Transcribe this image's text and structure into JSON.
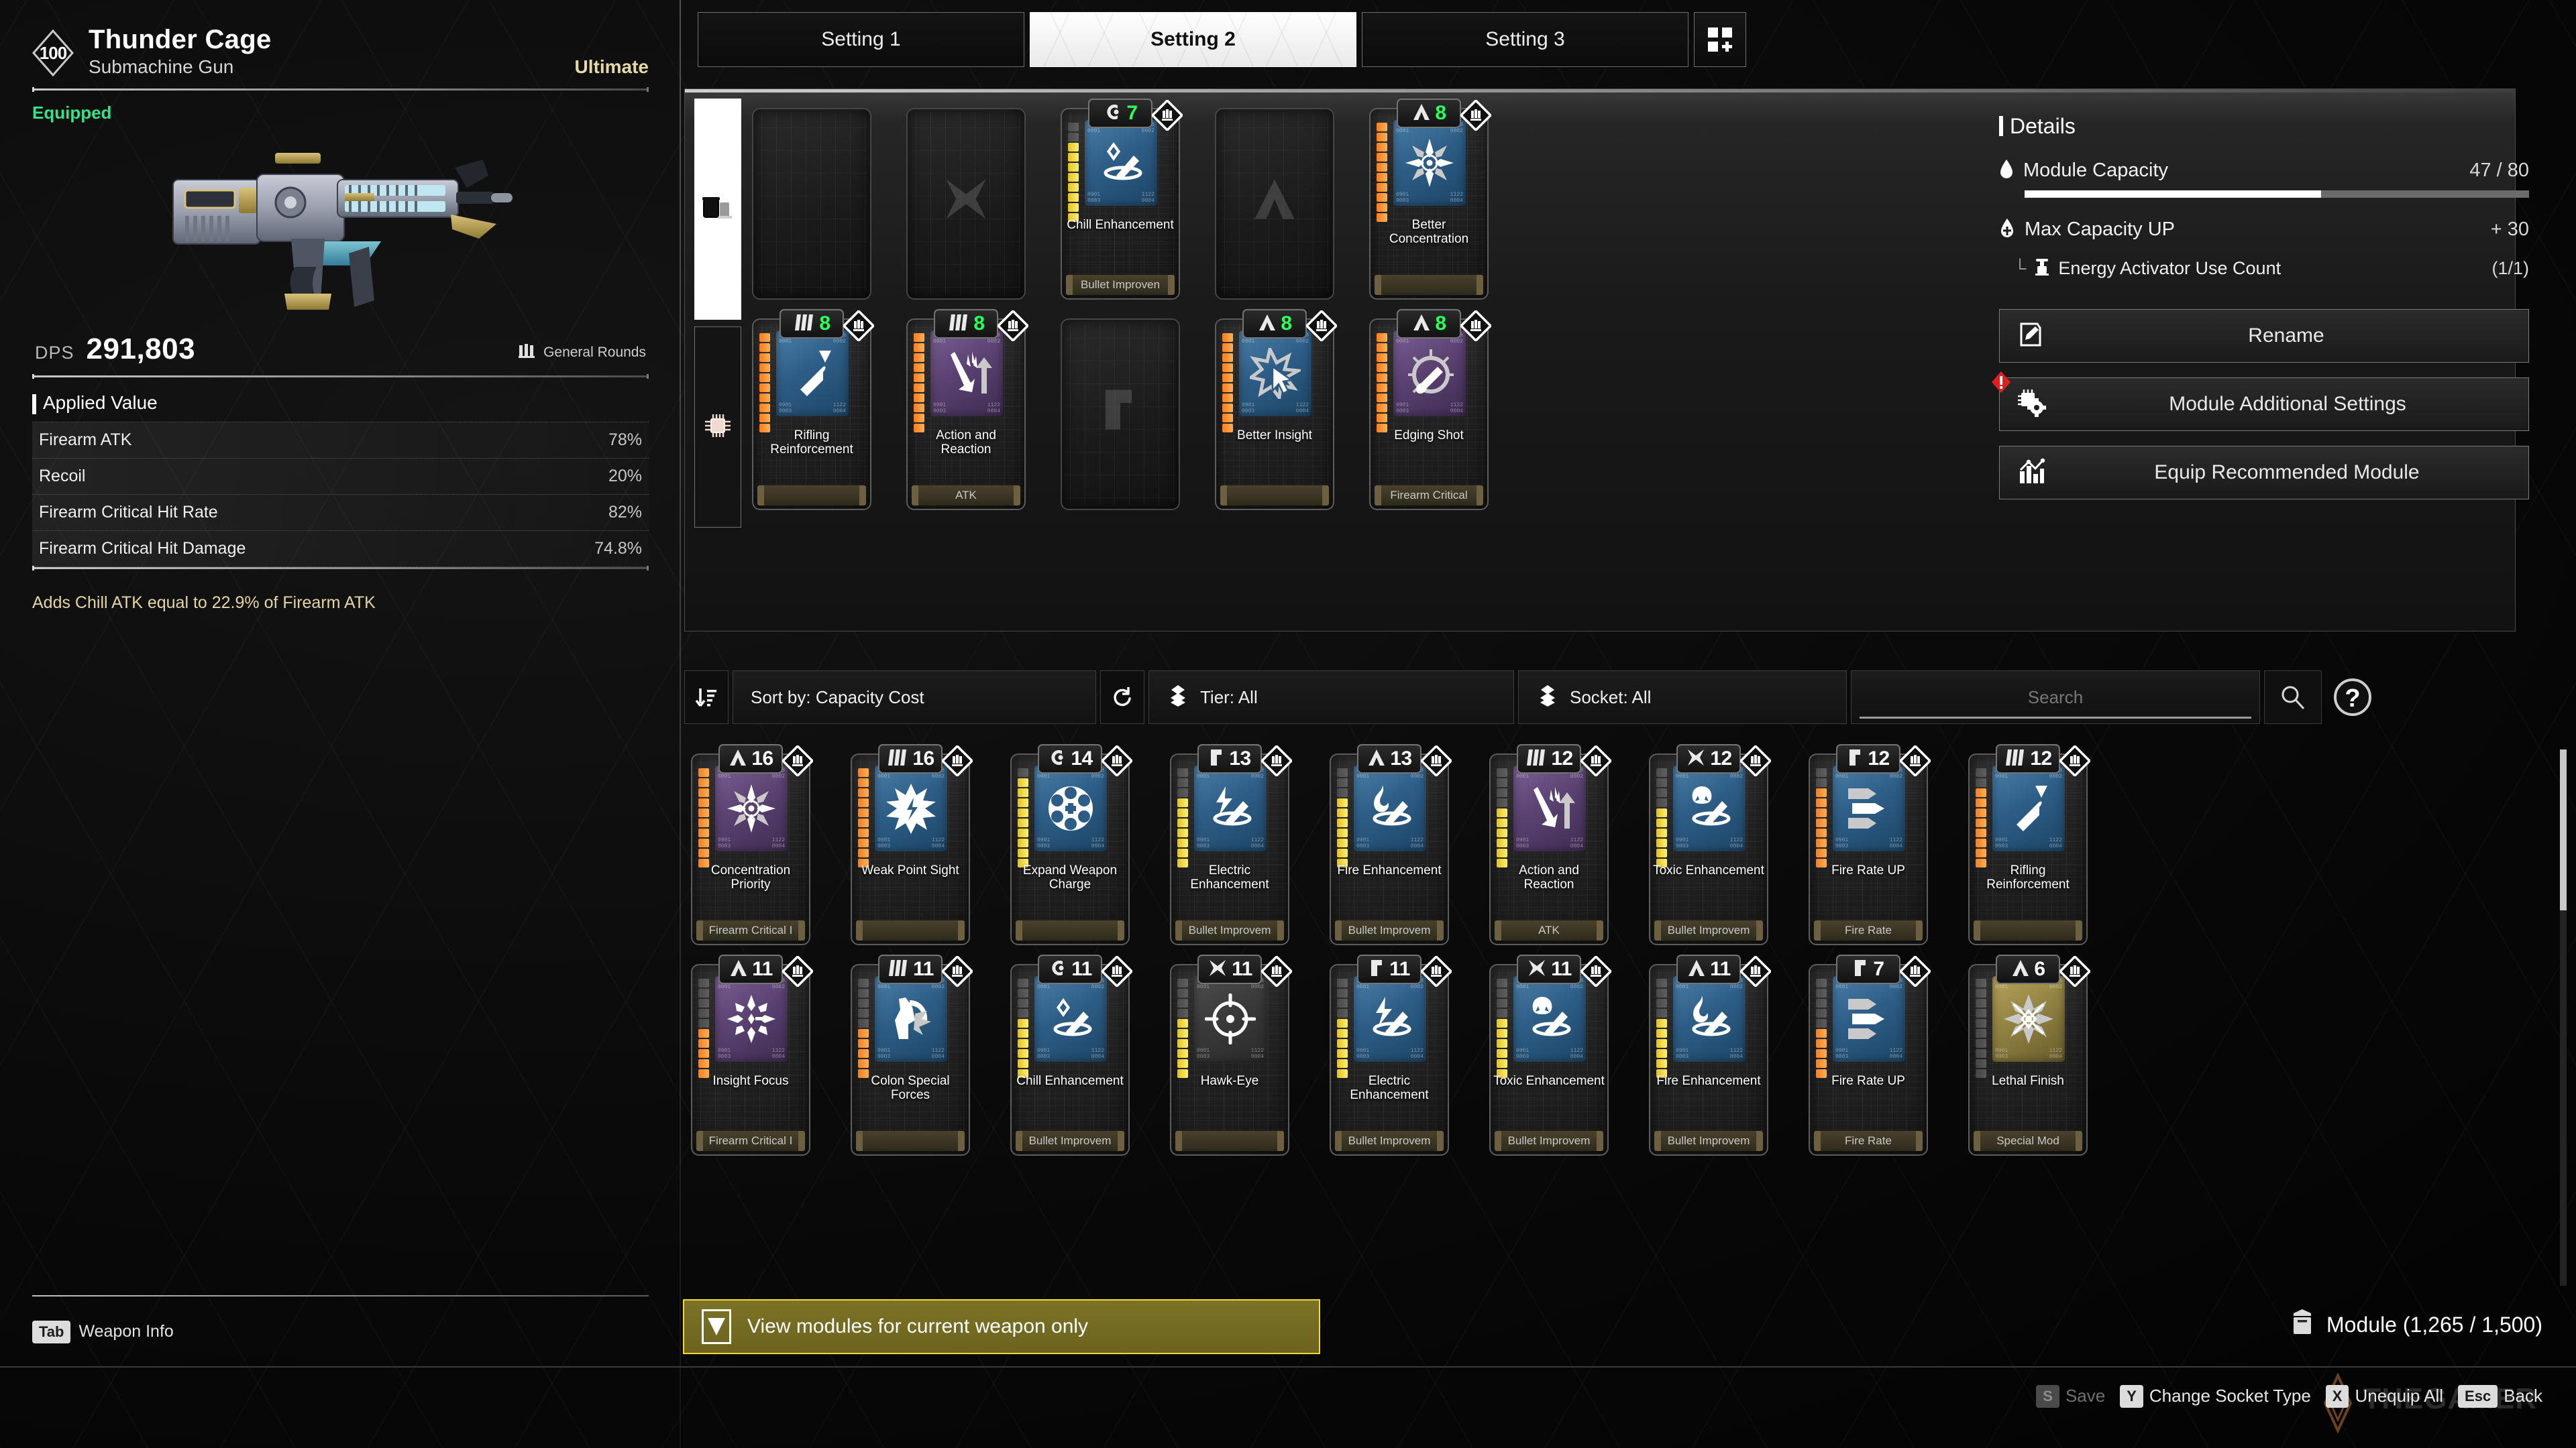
{
  "weapon": {
    "level": "100",
    "name": "Thunder Cage",
    "type": "Submachine Gun",
    "rarity": "Ultimate",
    "status": "Equipped",
    "dps_label": "DPS",
    "dps_value": "291,803",
    "ammo_type": "General Rounds",
    "applied_value_title": "Applied Value",
    "stats": [
      {
        "label": "Firearm ATK",
        "value": "78%"
      },
      {
        "label": "Recoil",
        "value": "20%"
      },
      {
        "label": "Firearm Critical Hit Rate",
        "value": "82%"
      },
      {
        "label": "Firearm Critical Hit Damage",
        "value": "74.8%"
      }
    ],
    "description": "Adds Chill ATK equal to 22.9% of Firearm ATK",
    "tab_hint_key": "Tab",
    "tab_hint_label": "Weapon Info"
  },
  "tabs": [
    {
      "label": "Setting 1",
      "active": false
    },
    {
      "label": "Setting 2",
      "active": true
    },
    {
      "label": "Setting 3",
      "active": false
    }
  ],
  "category_tabs": [
    {
      "icon": "weapon-module-icon",
      "selected": true
    },
    {
      "icon": "chip-module-icon",
      "selected": false
    }
  ],
  "details": {
    "title": "Details",
    "module_capacity_label": "Module Capacity",
    "module_capacity_value": "47 / 80",
    "module_capacity_pct": 58.75,
    "max_capacity_label": "Max Capacity UP",
    "max_capacity_value": "+ 30",
    "energy_activator_label": "Energy Activator Use Count",
    "energy_activator_value": "(1/1)",
    "buttons": [
      {
        "label": "Rename",
        "icon": "pencil-icon",
        "alert": false
      },
      {
        "label": "Module Additional Settings",
        "icon": "chip-gear-icon",
        "alert": true
      },
      {
        "label": "Equip Recommended Module",
        "icon": "chart-icon",
        "alert": false
      }
    ]
  },
  "equipped_slots": [
    {
      "empty": true,
      "socket": "none",
      "glyph": "none"
    },
    {
      "empty": true,
      "socket": "almandine",
      "glyph": "almandine"
    },
    {
      "empty": false,
      "cost": "7",
      "socket": "cerulean",
      "name": "Chill Enhancement",
      "category": "Bullet Improven",
      "tile": "blue",
      "icon": "chill-enhancement-icon",
      "pips": {
        "total": 10,
        "filled": 8,
        "color": "yellow"
      }
    },
    {
      "empty": true,
      "socket": "malachite",
      "glyph": "malachite"
    },
    {
      "empty": false,
      "cost": "8",
      "socket": "malachite",
      "name": "Better Concentration",
      "category": "",
      "tile": "blue",
      "icon": "concentration-icon",
      "pips": {
        "total": 10,
        "filled": 10,
        "color": "orange"
      }
    },
    {
      "empty": false,
      "cost": "8",
      "socket": "xantic",
      "name": "Rifling Reinforcement",
      "category": "",
      "tile": "blue",
      "icon": "rifling-icon",
      "pips": {
        "total": 10,
        "filled": 10,
        "color": "orange"
      }
    },
    {
      "empty": false,
      "cost": "8",
      "socket": "xantic",
      "name": "Action and Reaction",
      "category": "ATK",
      "tile": "purple",
      "icon": "action-reaction-icon",
      "pips": {
        "total": 10,
        "filled": 10,
        "color": "orange"
      }
    },
    {
      "empty": true,
      "socket": "rutile",
      "glyph": "rutile"
    },
    {
      "empty": false,
      "cost": "8",
      "socket": "malachite",
      "name": "Better Insight",
      "category": "",
      "tile": "blue",
      "icon": "better-insight-icon",
      "pips": {
        "total": 10,
        "filled": 10,
        "color": "orange"
      }
    },
    {
      "empty": false,
      "cost": "8",
      "socket": "malachite",
      "name": "Edging Shot",
      "category": "Firearm Critical",
      "tile": "purple",
      "icon": "edging-shot-icon",
      "pips": {
        "total": 10,
        "filled": 10,
        "color": "orange"
      }
    }
  ],
  "filter_bar": {
    "sort_label": "Sort by: Capacity Cost",
    "reset_icon": "reset-icon",
    "tier_label": "Tier: All",
    "socket_label": "Socket: All",
    "search_value": "",
    "search_placeholder": "Search",
    "search_icon": "search-icon",
    "help_icon": "help-icon"
  },
  "module_grid": [
    {
      "cost": "16",
      "socket": "malachite",
      "name": "Concentration Priority",
      "category": "Firearm Critical I",
      "tile": "purple",
      "icon": "concentration-icon",
      "pips": {
        "total": 10,
        "filled": 10,
        "color": "orange"
      }
    },
    {
      "cost": "16",
      "socket": "xantic",
      "name": "Weak Point Sight",
      "category": "",
      "tile": "blue",
      "icon": "weak-point-icon",
      "pips": {
        "total": 10,
        "filled": 10,
        "color": "orange"
      }
    },
    {
      "cost": "14",
      "socket": "cerulean",
      "name": "Expand Weapon Charge",
      "category": "",
      "tile": "blue",
      "icon": "revolver-icon",
      "pips": {
        "total": 10,
        "filled": 9,
        "color": "yellow"
      }
    },
    {
      "cost": "13",
      "socket": "rutile",
      "name": "Electric Enhancement",
      "category": "Bullet Improvem",
      "tile": "blue",
      "icon": "electric-enhancement-icon",
      "pips": {
        "total": 10,
        "filled": 7,
        "color": "yellow"
      }
    },
    {
      "cost": "13",
      "socket": "malachite",
      "name": "Fire Enhancement",
      "category": "Bullet Improvem",
      "tile": "blue",
      "icon": "fire-enhancement-icon",
      "pips": {
        "total": 10,
        "filled": 7,
        "color": "yellow"
      }
    },
    {
      "cost": "12",
      "socket": "xantic",
      "name": "Action and Reaction",
      "category": "ATK",
      "tile": "purple",
      "icon": "action-reaction-icon",
      "pips": {
        "total": 10,
        "filled": 6,
        "color": "yellow"
      }
    },
    {
      "cost": "12",
      "socket": "almandine",
      "name": "Toxic Enhancement",
      "category": "Bullet Improvem",
      "tile": "blue",
      "icon": "toxic-enhancement-icon",
      "pips": {
        "total": 10,
        "filled": 6,
        "color": "yellow"
      }
    },
    {
      "cost": "12",
      "socket": "rutile",
      "name": "Fire Rate UP",
      "category": "Fire Rate",
      "tile": "blue",
      "icon": "bullets-icon",
      "pips": {
        "total": 10,
        "filled": 8,
        "color": "orange"
      }
    },
    {
      "cost": "12",
      "socket": "xantic",
      "name": "Rifling Reinforcement",
      "category": "",
      "tile": "blue",
      "icon": "rifling-icon",
      "pips": {
        "total": 10,
        "filled": 8,
        "color": "orange"
      }
    },
    {
      "cost": "11",
      "socket": "malachite",
      "name": "Insight Focus",
      "category": "Firearm Critical I",
      "tile": "purple",
      "icon": "insight-focus-icon",
      "pips": {
        "total": 10,
        "filled": 5,
        "color": "orange"
      }
    },
    {
      "cost": "11",
      "socket": "xantic",
      "name": "Colon Special Forces",
      "category": "",
      "tile": "blue",
      "icon": "wolf-icon",
      "pips": {
        "total": 10,
        "filled": 5,
        "color": "orange"
      }
    },
    {
      "cost": "11",
      "socket": "cerulean",
      "name": "Chill Enhancement",
      "category": "Bullet Improvem",
      "tile": "blue",
      "icon": "chill-enhancement-icon",
      "pips": {
        "total": 10,
        "filled": 6,
        "color": "yellow"
      }
    },
    {
      "cost": "11",
      "socket": "almandine",
      "name": "Hawk-Eye",
      "category": "",
      "tile": "grey",
      "icon": "hawkeye-icon",
      "pips": {
        "total": 10,
        "filled": 6,
        "color": "yellow"
      }
    },
    {
      "cost": "11",
      "socket": "rutile",
      "name": "Electric Enhancement",
      "category": "Bullet Improvem",
      "tile": "blue",
      "icon": "electric-enhancement-icon",
      "pips": {
        "total": 10,
        "filled": 6,
        "color": "yellow"
      }
    },
    {
      "cost": "11",
      "socket": "almandine",
      "name": "Toxic Enhancement",
      "category": "Bullet Improvem",
      "tile": "blue",
      "icon": "toxic-enhancement-icon",
      "pips": {
        "total": 10,
        "filled": 6,
        "color": "yellow"
      }
    },
    {
      "cost": "11",
      "socket": "malachite",
      "name": "Fire Enhancement",
      "category": "Bullet Improvem",
      "tile": "blue",
      "icon": "fire-enhancement-icon",
      "pips": {
        "total": 10,
        "filled": 6,
        "color": "yellow"
      }
    },
    {
      "cost": "7",
      "socket": "rutile",
      "name": "Fire Rate UP",
      "category": "Fire Rate",
      "tile": "blue",
      "icon": "bullets-icon",
      "pips": {
        "total": 10,
        "filled": 5,
        "color": "orange"
      }
    },
    {
      "cost": "6",
      "socket": "malachite",
      "name": "Lethal Finish",
      "category": "Special Mod",
      "tile": "gold",
      "icon": "lethal-finish-icon",
      "pips": {
        "total": 10,
        "filled": 0,
        "color": "grey"
      }
    }
  ],
  "bottom": {
    "checkbox_label": "View modules for current weapon only",
    "checkbox_checked": true,
    "module_count_label": "Module (1,265 / 1,500)",
    "module_count_icon": "module-box-icon"
  },
  "key_hints": [
    {
      "key": "S",
      "label": "Save",
      "dim": true
    },
    {
      "key": "Y",
      "label": "Change Socket Type",
      "dim": false
    },
    {
      "key": "X",
      "label": "Unequip All",
      "dim": false
    },
    {
      "key": "Esc",
      "label": "Back",
      "dim": false
    }
  ],
  "watermark": "THEGAMER",
  "colors": {
    "accent_gold": "#e3d5a4",
    "equipped_green": "#39e08a",
    "cost_green": "#2bff5a",
    "checkbox_yellow": "#f2d935",
    "alert_red": "#e02020"
  }
}
